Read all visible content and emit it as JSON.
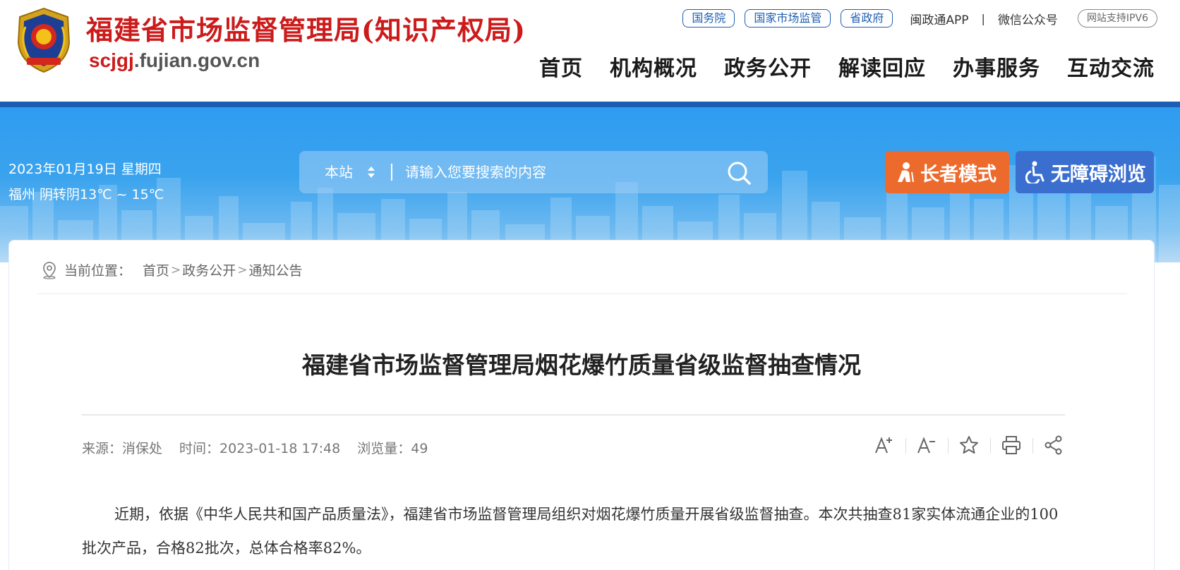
{
  "header": {
    "site_name": "福建省市场监督管理局(知识产权局)",
    "domain_highlight": "scjgj",
    "domain_rest": ".fujian.gov.cn",
    "top_links": [
      "国务院",
      "国家市场监管",
      "省政府"
    ],
    "app_link": "闽政通APP",
    "separator": "|",
    "wechat_link": "微信公众号",
    "ipv6_badge": "网站支持IPV6",
    "nav": [
      "首页",
      "机构概况",
      "政务公开",
      "解读回应",
      "办事服务",
      "互动交流"
    ]
  },
  "banner": {
    "date": "2023年01月19日 星期四",
    "weather": "福州 阴转阴13℃ ~ 15℃",
    "search": {
      "scope": "本站",
      "placeholder": "请输入您要搜索的内容"
    },
    "elder_mode": "长者模式",
    "accessibility": "无障碍浏览"
  },
  "breadcrumb": {
    "label": "当前位置：",
    "items": [
      "首页",
      "政务公开",
      "通知公告"
    ],
    "separator": ">"
  },
  "article": {
    "title": "福建省市场监督管理局烟花爆竹质量省级监督抽查情况",
    "source": "来源：消保处",
    "time": "时间：2023-01-18 17:48",
    "views": "浏览量：49",
    "paragraph": "近期，依据《中华人民共和国产品质量法》，福建省市场监督管理局组织对烟花爆竹质量开展省级监督抽查。本次共抽查81家实体流通企业的100批次产品，合格82批次，总体合格率82%。"
  },
  "tools": [
    "font-increase-icon",
    "font-decrease-icon",
    "favorite-icon",
    "print-icon",
    "share-icon"
  ],
  "colors": {
    "brand_red": "#cc1b1b",
    "nav_blue": "#1a5fb4",
    "elder_orange": "#ec6a2c",
    "access_blue": "#3a6fd0"
  }
}
